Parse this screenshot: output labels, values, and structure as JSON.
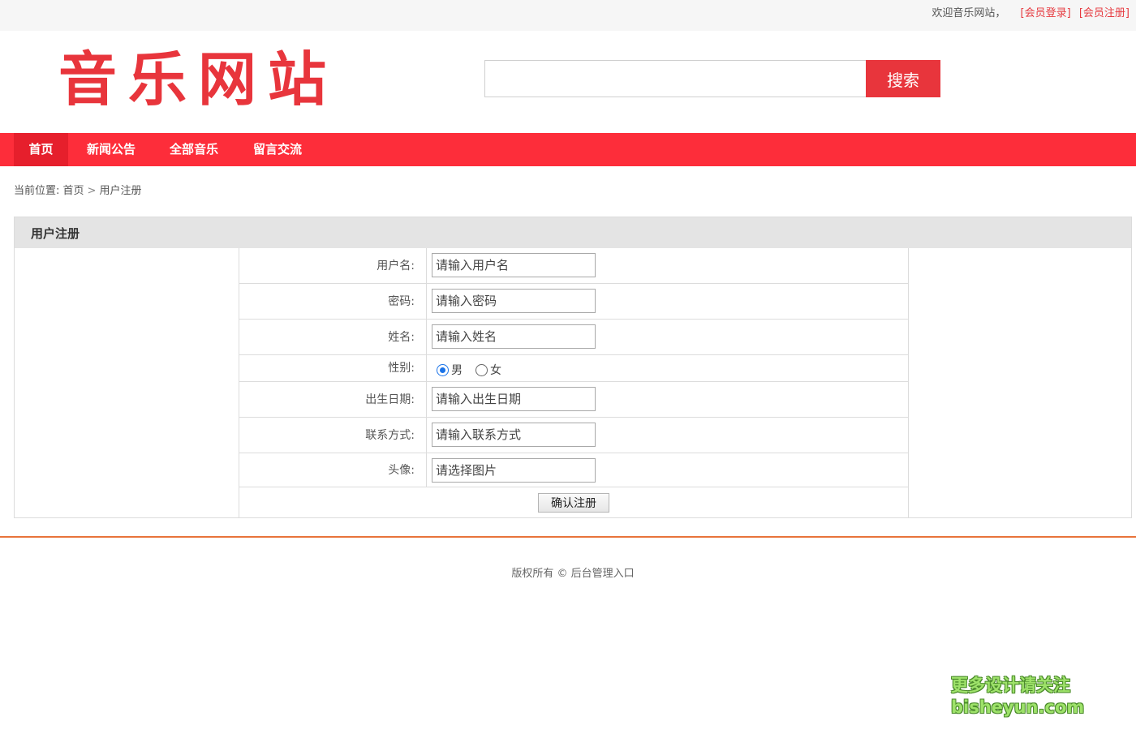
{
  "topbar": {
    "welcome": "欢迎音乐网站，",
    "login": "[会员登录]",
    "register": "[会员注册]"
  },
  "header": {
    "logo_text": "音乐网站",
    "search": {
      "value": "",
      "placeholder": "",
      "button": "搜索"
    }
  },
  "nav": {
    "items": [
      {
        "label": "首页",
        "active": true
      },
      {
        "label": "新闻公告"
      },
      {
        "label": "全部音乐"
      },
      {
        "label": "留言交流"
      }
    ]
  },
  "breadcrumb": {
    "prefix": "当前位置:",
    "home": "首页",
    "separator": ">",
    "current": "用户注册"
  },
  "form": {
    "title": "用户注册",
    "username": {
      "label": "用户名:",
      "placeholder": "请输入用户名"
    },
    "password": {
      "label": "密码:",
      "placeholder": "请输入密码"
    },
    "name": {
      "label": "姓名:",
      "placeholder": "请输入姓名"
    },
    "gender": {
      "label": "性别:",
      "options": [
        "男",
        "女"
      ],
      "selected": "男"
    },
    "birthday": {
      "label": "出生日期:",
      "placeholder": "请输入出生日期"
    },
    "contact": {
      "label": "联系方式:",
      "placeholder": "请输入联系方式"
    },
    "avatar": {
      "label": "头像:",
      "placeholder": "请选择图片"
    },
    "submit": "确认注册"
  },
  "footer": {
    "copyright": "版权所有 ©",
    "admin_link": "后台管理入口"
  },
  "watermark": {
    "line1": "更多设计请关注",
    "line2": "bisheyun.com"
  },
  "colors": {
    "brand_red": "#e8353c",
    "nav_red": "#fd2d3a",
    "footer_line": "#e8743b"
  }
}
